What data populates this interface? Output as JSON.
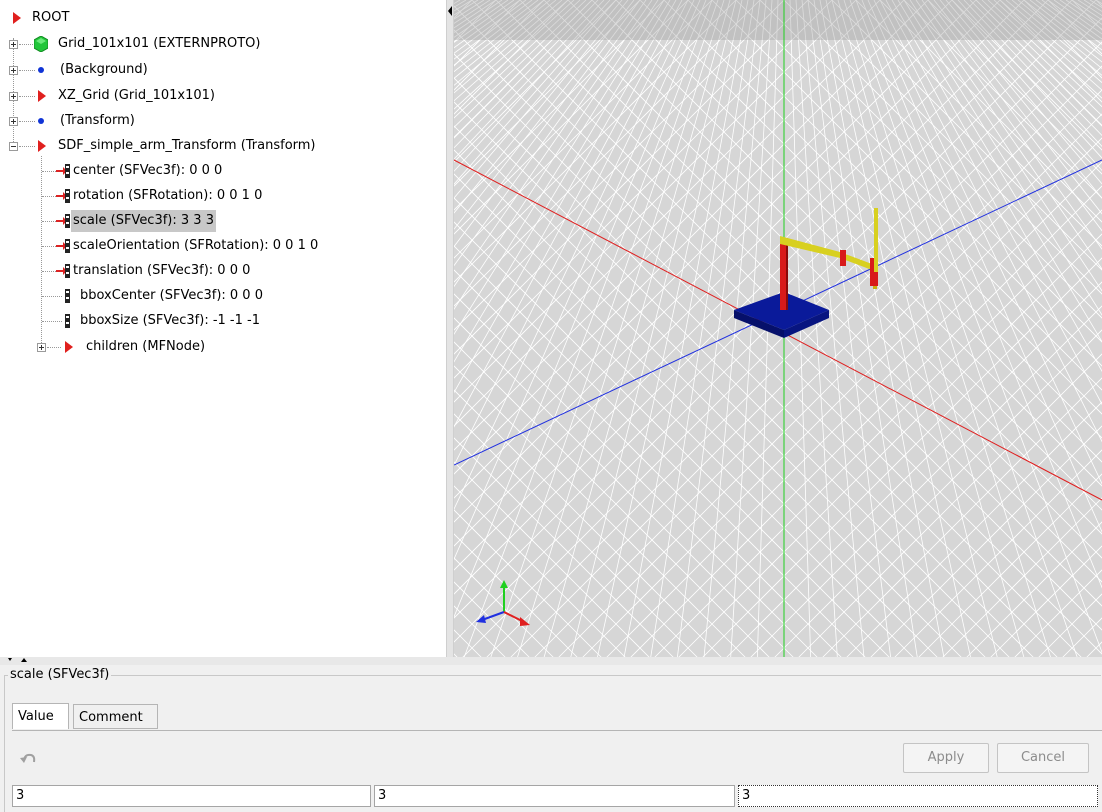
{
  "tree": {
    "nodes": [
      {
        "label": "ROOT",
        "icon": "red-triangle"
      },
      {
        "label": "Grid_101x101 (EXTERNPROTO)",
        "icon": "green-hexagon"
      },
      {
        "label": "(Background)",
        "icon": "blue-dot"
      },
      {
        "label": "XZ_Grid (Grid_101x101)",
        "icon": "red-triangle"
      },
      {
        "label": "(Transform)",
        "icon": "blue-dot"
      },
      {
        "label": "SDF_simple_arm_Transform (Transform)",
        "icon": "red-triangle"
      },
      {
        "label": "center (SFVec3f): 0  0  0",
        "icon": "input-output-field"
      },
      {
        "label": "rotation (SFRotation): 0  0  1  0",
        "icon": "input-output-field"
      },
      {
        "label": "scale (SFVec3f): 3  3  3",
        "icon": "input-output-field",
        "selected": true
      },
      {
        "label": "scaleOrientation (SFRotation): 0  0  1  0",
        "icon": "input-output-field"
      },
      {
        "label": "translation (SFVec3f): 0  0  0",
        "icon": "input-output-field"
      },
      {
        "label": "bboxCenter (SFVec3f): 0  0  0",
        "icon": "initialize-field"
      },
      {
        "label": "bboxSize (SFVec3f): -1  -1  -1",
        "icon": "initialize-field"
      },
      {
        "label": "children (MFNode)",
        "icon": "red-triangle"
      }
    ]
  },
  "viewport": {
    "background_color": "#d6d6d6",
    "grid_color": "#ffffff",
    "axis_colors": {
      "x": "#e02020",
      "y": "#20d020",
      "z": "#2030e0"
    }
  },
  "editor": {
    "group_title": "scale (SFVec3f)",
    "tabs": [
      {
        "label": "Value",
        "active": true
      },
      {
        "label": "Comment",
        "active": false
      }
    ],
    "undo_icon": "undo-icon",
    "apply_label": "Apply",
    "cancel_label": "Cancel",
    "values": [
      "3",
      "3",
      "3"
    ]
  }
}
